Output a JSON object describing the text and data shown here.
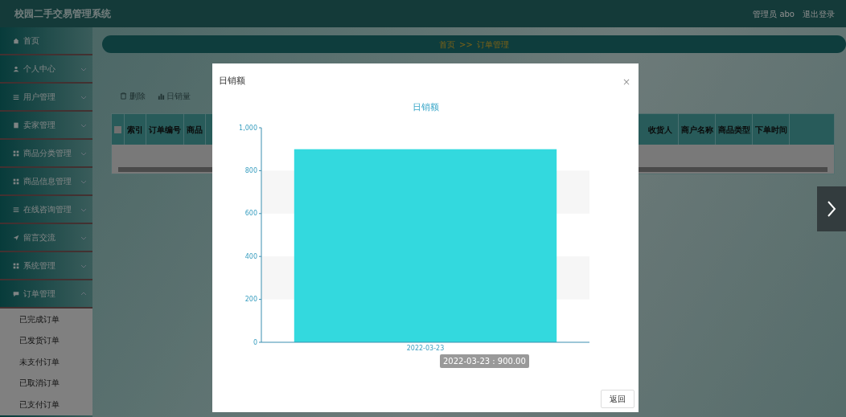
{
  "header": {
    "title": "校园二手交易管理系统",
    "user": "管理员 abo",
    "logout": "退出登录"
  },
  "sidebar": {
    "items": [
      {
        "label": "首页"
      },
      {
        "label": "个人中心",
        "expanded": false
      },
      {
        "label": "用户管理",
        "expanded": false
      },
      {
        "label": "卖家管理",
        "expanded": false
      },
      {
        "label": "商品分类管理",
        "expanded": false
      },
      {
        "label": "商品信息管理",
        "expanded": false
      },
      {
        "label": "在线咨询管理",
        "expanded": false
      },
      {
        "label": "留言交流",
        "expanded": false
      },
      {
        "label": "系统管理",
        "expanded": false
      },
      {
        "label": "订单管理",
        "expanded": true,
        "children": [
          {
            "label": "已完成订单"
          },
          {
            "label": "已发货订单"
          },
          {
            "label": "未支付订单"
          },
          {
            "label": "已取消订单"
          },
          {
            "label": "已支付订单"
          }
        ]
      }
    ]
  },
  "breadcrumb": [
    "首页",
    ">>",
    "订单管理"
  ],
  "toolbar": [
    "删除",
    "日销量"
  ],
  "table": {
    "select_all_checked": false,
    "columns_left": [
      "索引",
      "订单编号",
      "商品"
    ],
    "columns_right": [
      "收货人",
      "商户名称",
      "商品类型",
      "下单时间"
    ]
  },
  "modal": {
    "title": "日销额",
    "close": "×",
    "button": "返回",
    "chart_data": {
      "type": "bar",
      "title": "日销额",
      "categories": [
        "2022-03-23"
      ],
      "series": [
        {
          "color": "#33d9de",
          "values": [
            900
          ]
        }
      ],
      "ylim": [
        0,
        1000
      ],
      "yticks": [
        0,
        200,
        400,
        600,
        800,
        {
          "value": 1000,
          "label": "1,000"
        }
      ]
    },
    "tooltip": "2022-03-23 : 900.00"
  }
}
